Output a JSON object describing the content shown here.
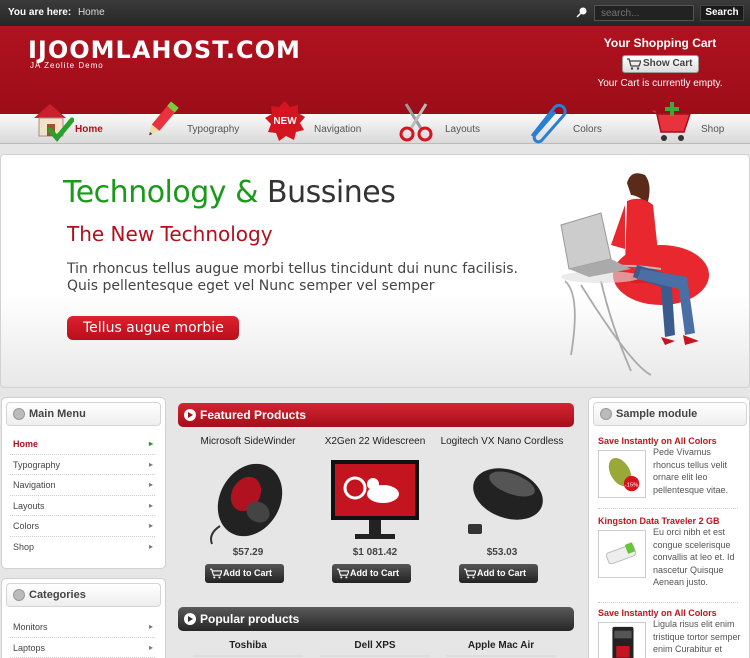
{
  "topbar": {
    "here_label": "You are here:",
    "breadcrumb": "Home",
    "search_placeholder": "search...",
    "search_button": "Search"
  },
  "header": {
    "logo": "IJOOMLAHOST.COM",
    "logo_sub": "JA Zeolite Demo",
    "cart_title": "Your Shopping Cart",
    "show_cart": "Show Cart",
    "cart_status": "Your Cart is currently empty."
  },
  "nav": {
    "items": [
      {
        "label": "Home",
        "icon": "home-icon",
        "active": true
      },
      {
        "label": "Typography",
        "icon": "pencil-icon"
      },
      {
        "label": "Navigation",
        "icon": "new-badge-icon"
      },
      {
        "label": "Layouts",
        "icon": "scissors-icon"
      },
      {
        "label": "Colors",
        "icon": "paperclip-icon"
      },
      {
        "label": "Shop",
        "icon": "shopping-cart-icon"
      }
    ]
  },
  "banner": {
    "title_green": "Technology &",
    "title_dark": "Bussines",
    "subtitle": "The New Technology",
    "text": "Tin rhoncus tellus augue morbi tellus tincidunt dui nunc facilisis. Quis pellentesque eget vel Nunc semper vel semper",
    "button": "Tellus augue morbie"
  },
  "main_menu": {
    "title": "Main Menu",
    "items": [
      "Home",
      "Typography",
      "Navigation",
      "Layouts",
      "Colors",
      "Shop"
    ]
  },
  "categories": {
    "title": "Categories",
    "items": [
      "Monitors",
      "Laptops"
    ]
  },
  "featured": {
    "title": "Featured Products",
    "products": [
      {
        "name": "Microsoft SideWinder",
        "price": "$57.29",
        "button": "Add to Cart"
      },
      {
        "name": "X2Gen 22 Widescreen",
        "price": "$1 081.42",
        "button": "Add to Cart"
      },
      {
        "name": "Logitech VX Nano Cordless",
        "price": "$53.03",
        "button": "Add to Cart"
      }
    ]
  },
  "popular": {
    "title": "Popular products",
    "products": [
      "Toshiba",
      "Dell XPS",
      "Apple Mac Air"
    ]
  },
  "sample": {
    "title": "Sample module",
    "items": [
      {
        "title": "Save Instantly on All Colors",
        "text": "Pede Vivamus rhoncus tellus velit ornare elit leo pellentesque vitae."
      },
      {
        "title": "Kingston Data Traveler 2 GB",
        "text": "Eu orci nibh et est congue scelerisque convallis at leo et. Id nascetur Quisque Aenean justo."
      },
      {
        "title": "Save Instantly on All Colors",
        "text": "Ligula risus elit enim tristique tortor semper enim Curabitur et"
      }
    ]
  },
  "colors": {
    "brand_red": "#b0121f",
    "accent_green": "#1a9a1a",
    "dark": "#262626"
  }
}
